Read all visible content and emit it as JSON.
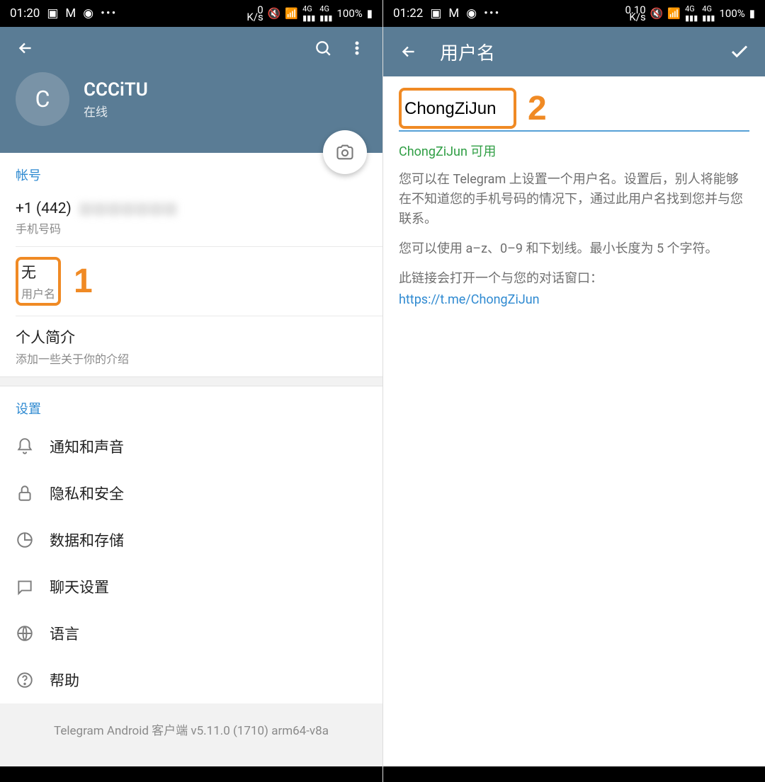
{
  "screen1": {
    "status": {
      "time": "01:20",
      "net": "0\nK/s",
      "battery": "100%"
    },
    "appbar": {},
    "profile": {
      "avatar_initial": "C",
      "name": "CCCiTU",
      "status": "在线"
    },
    "account_header": "帐号",
    "phone": {
      "value": "+1 (442)",
      "rest": "XXXXXXX",
      "label": "手机号码"
    },
    "username": {
      "value": "无",
      "label": "用户名"
    },
    "bio": {
      "value": "个人简介",
      "label": "添加一些关于你的介绍"
    },
    "settings_header": "设置",
    "settings": [
      {
        "label": "通知和声音"
      },
      {
        "label": "隐私和安全"
      },
      {
        "label": "数据和存储"
      },
      {
        "label": "聊天设置"
      },
      {
        "label": "语言"
      },
      {
        "label": "帮助"
      }
    ],
    "footer": "Telegram Android 客户端 v5.11.0 (1710) arm64-v8a",
    "annotation_num": "1"
  },
  "screen2": {
    "status": {
      "time": "01:22",
      "net": "0.10\nK/s",
      "battery": "100%"
    },
    "appbar": {
      "title": "用户名"
    },
    "input_value": "ChongZiJun",
    "available": "ChongZiJun 可用",
    "desc1": "您可以在 Telegram 上设置一个用户名。设置后，别人将能够在不知道您的手机号码的情况下，通过此用户名找到您并与您联系。",
    "desc2": "您可以使用 a–z、0–9 和下划线。最小长度为 5 个字符。",
    "desc3": "此链接会打开一个与您的对话窗口：",
    "link": "https://t.me/ChongZiJun",
    "annotation_num": "2"
  }
}
